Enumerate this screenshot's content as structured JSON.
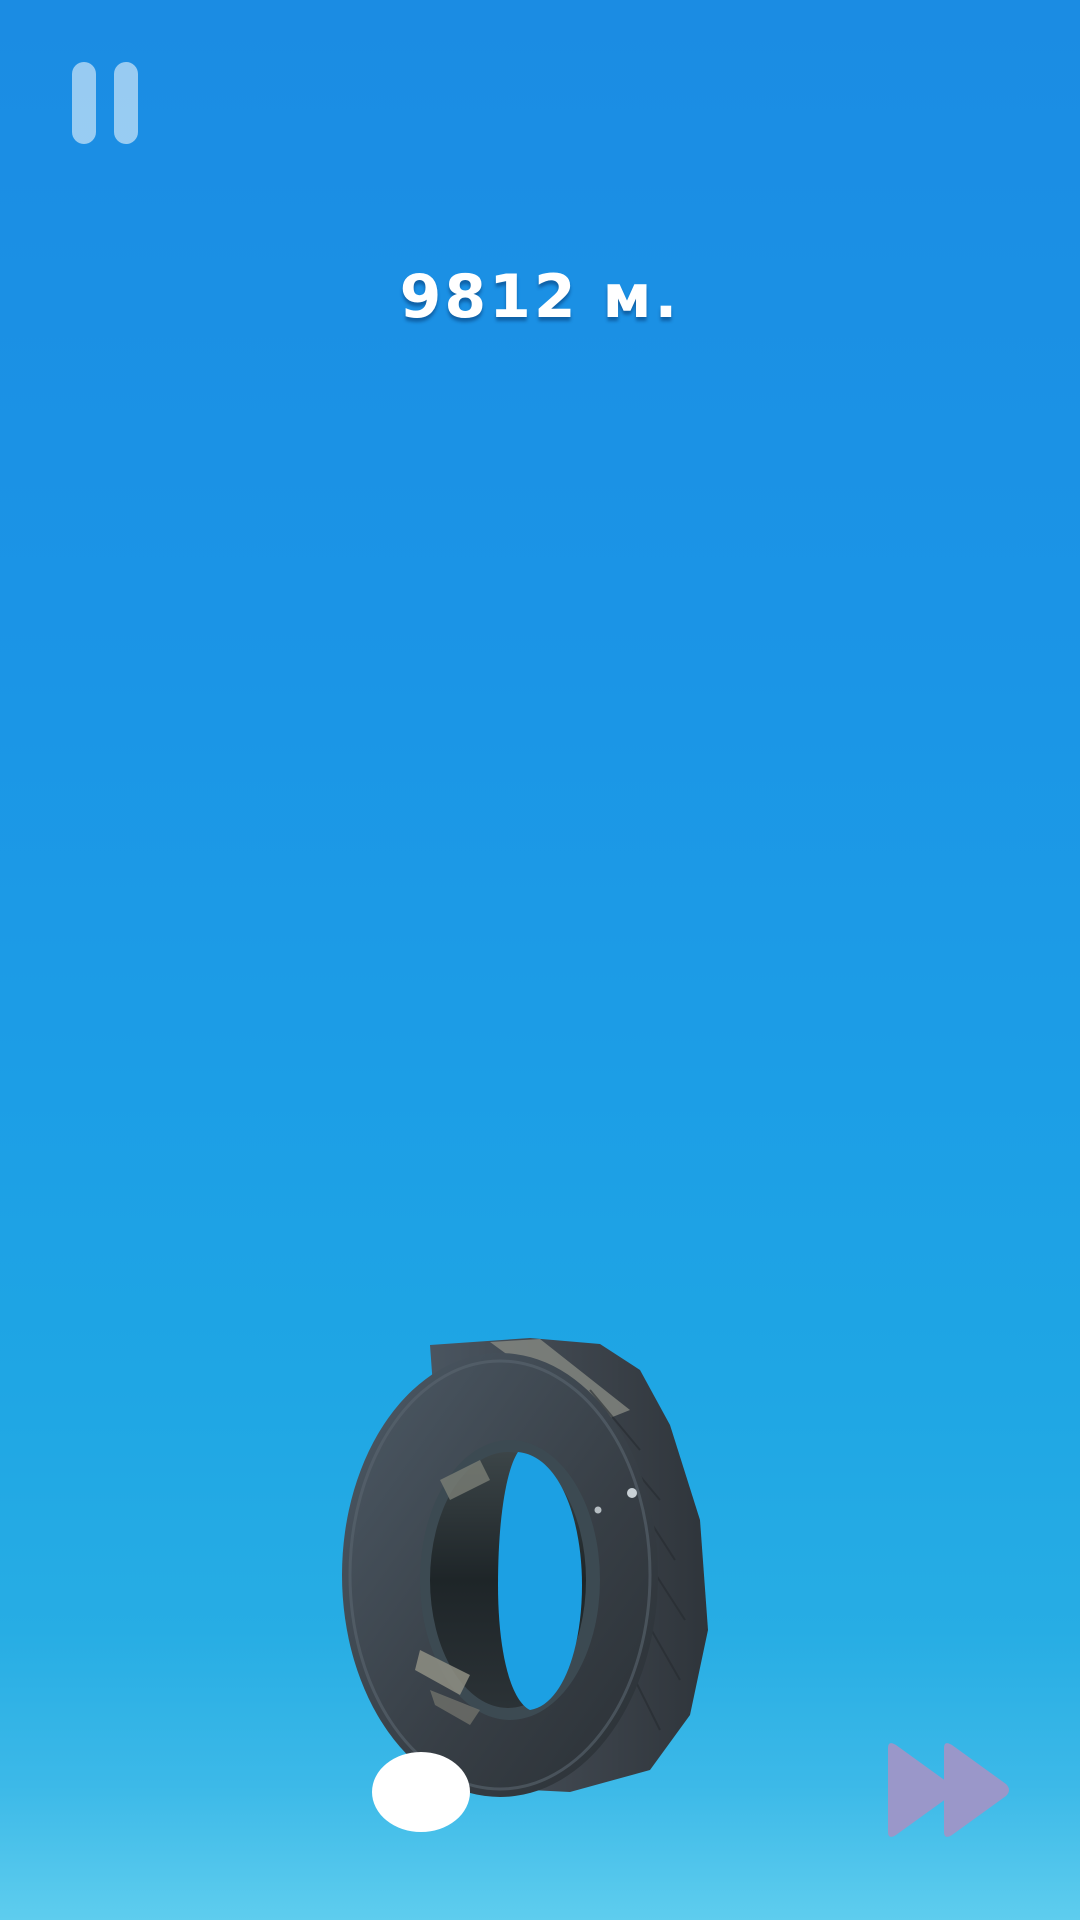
{
  "hud": {
    "distance_value": "9812",
    "distance_unit": "м."
  },
  "icons": {
    "pause": "pause-icon",
    "fast_forward": "fast-forward-icon",
    "player": "tire-icon"
  },
  "colors": {
    "sky_top": "#1b8ce3",
    "sky_bottom": "#5ecdee",
    "pause_icon": "#8fc4f1",
    "fast_forward_icon": "#9a97c9",
    "tire": "#3a4048"
  }
}
